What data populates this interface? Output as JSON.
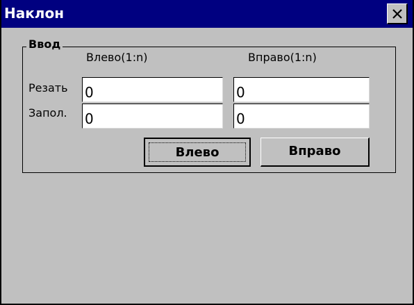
{
  "window": {
    "title": "Наклон"
  },
  "group": {
    "title": "Ввод",
    "columns": {
      "left": "Влево(1:n)",
      "right": "Вправо(1:n)"
    },
    "rows": [
      {
        "label": "Резать",
        "left_value": "0",
        "right_value": "0"
      },
      {
        "label": "Запол.",
        "left_value": "0",
        "right_value": "0"
      }
    ]
  },
  "buttons": {
    "left": "Влево",
    "right": "Вправо"
  },
  "icons": {
    "close": "close-icon"
  },
  "colors": {
    "titlebar": "#000080",
    "face": "#c0c0c0"
  }
}
